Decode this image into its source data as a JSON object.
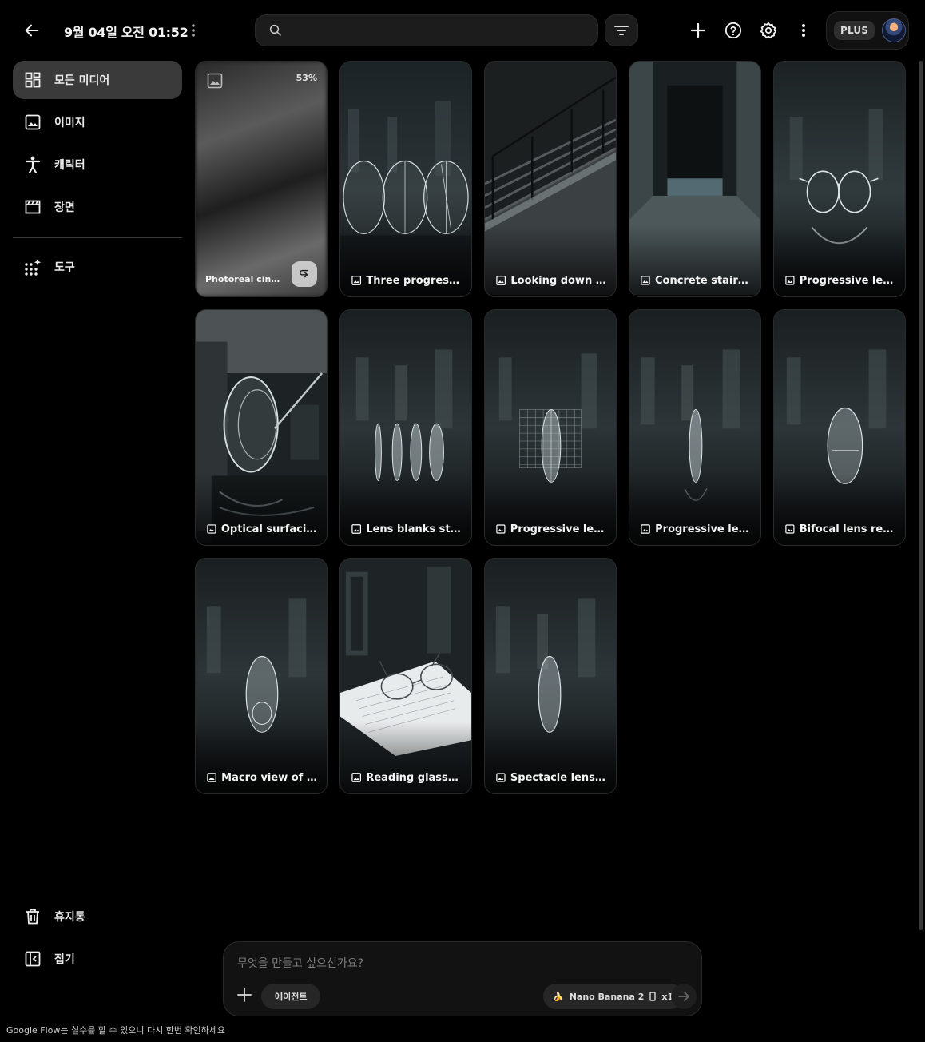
{
  "header": {
    "title": "9월 04일 오전 01:52",
    "search_placeholder": "",
    "plan_badge": "PLUS"
  },
  "sidebar": {
    "items": [
      {
        "label": "모든 미디어",
        "icon": "grid-icon",
        "active": true
      },
      {
        "label": "이미지",
        "icon": "image-icon",
        "active": false
      },
      {
        "label": "캐릭터",
        "icon": "person-icon",
        "active": false
      },
      {
        "label": "장면",
        "icon": "clapperboard-icon",
        "active": false
      }
    ],
    "tools": {
      "label": "도구",
      "icon": "sparkle-grid-icon"
    },
    "bottom": [
      {
        "label": "휴지통",
        "icon": "trash-icon"
      },
      {
        "label": "접기",
        "icon": "collapse-panel-icon"
      }
    ]
  },
  "media": {
    "loading": {
      "caption": "Photoreal cinema...",
      "progress": "53%"
    },
    "cards": [
      {
        "caption": "Three progressiv..."
      },
      {
        "caption": "Looking down co..."
      },
      {
        "caption": "Concrete staircas..."
      },
      {
        "caption": "Progressive lens i..."
      },
      {
        "caption": "Optical surfacing ..."
      },
      {
        "caption": "Lens blanks stan..."
      },
      {
        "caption": "Progressive lens r..."
      },
      {
        "caption": "Progressive lens ..."
      },
      {
        "caption": "Bifocal lens reflec..."
      },
      {
        "caption": "Macro view of bif..."
      },
      {
        "caption": "Reading glasses ..."
      },
      {
        "caption": "Spectacle lens on..."
      }
    ]
  },
  "composer": {
    "placeholder": "무엇을 만들고 싶으신가요?",
    "agent_label": "에이전트",
    "model_emoji": "🍌",
    "model_label": "Nano Banana 2",
    "count_label": "x1"
  },
  "footer": {
    "disclaimer": "Google Flow는 실수를 할 수 있으니 다시 한번 확인하세요"
  }
}
